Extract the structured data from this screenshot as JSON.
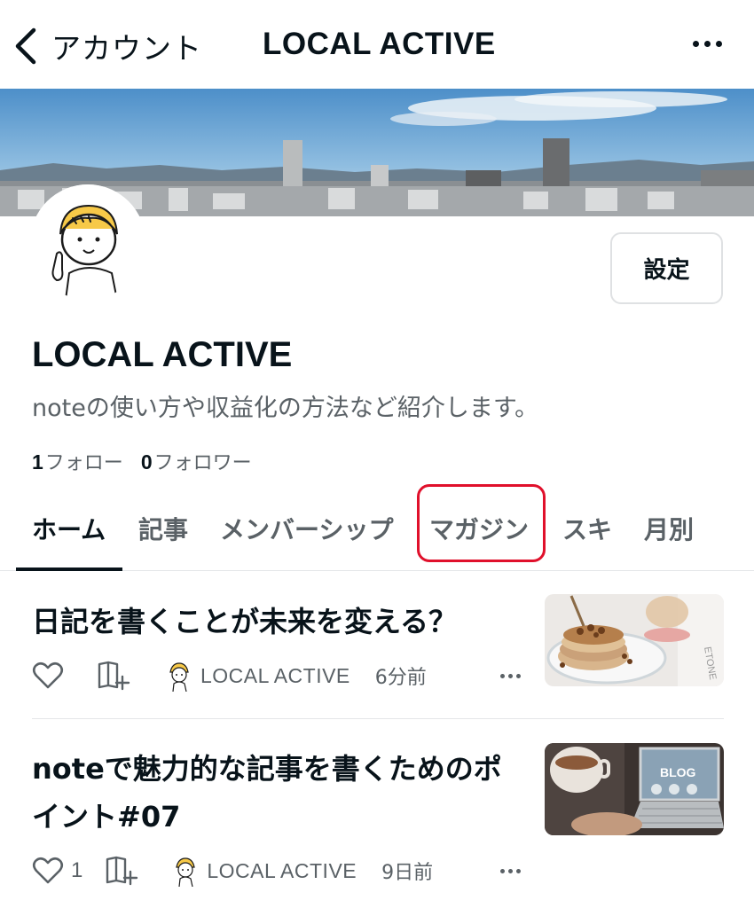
{
  "header": {
    "back_label": "アカウント",
    "title": "LOCAL ACTIVE",
    "back_icon": "chevron-left-icon",
    "more_icon": "more-horizontal-icon"
  },
  "profile": {
    "name": "LOCAL ACTIVE",
    "description": "noteの使い方や収益化の方法など紹介します。",
    "settings_label": "設定",
    "follow_count": "1",
    "follow_label": "フォロー",
    "follower_count": "0",
    "follower_label": "フォロワー"
  },
  "tabs": [
    {
      "label": "ホーム",
      "active": true
    },
    {
      "label": "記事",
      "active": false
    },
    {
      "label": "メンバーシップ",
      "active": false
    },
    {
      "label": "マガジン",
      "active": false,
      "highlighted": true
    },
    {
      "label": "スキ",
      "active": false
    },
    {
      "label": "月別",
      "active": false
    }
  ],
  "articles": [
    {
      "title": "日記を書くことが未来を変える？",
      "like_count": "",
      "author": "LOCAL ACTIVE",
      "time": "6分前",
      "thumbnail": "pancake-photo"
    },
    {
      "title": "noteで魅力的な記事を書くためのポイント#07",
      "like_count": "1",
      "author": "LOCAL ACTIVE",
      "time": "9日前",
      "thumbnail": "laptop-blog-photo"
    }
  ],
  "colors": {
    "text": "#08131a",
    "muted": "#5a6166",
    "highlight": "#e0102b",
    "border": "#dfe1e3"
  }
}
